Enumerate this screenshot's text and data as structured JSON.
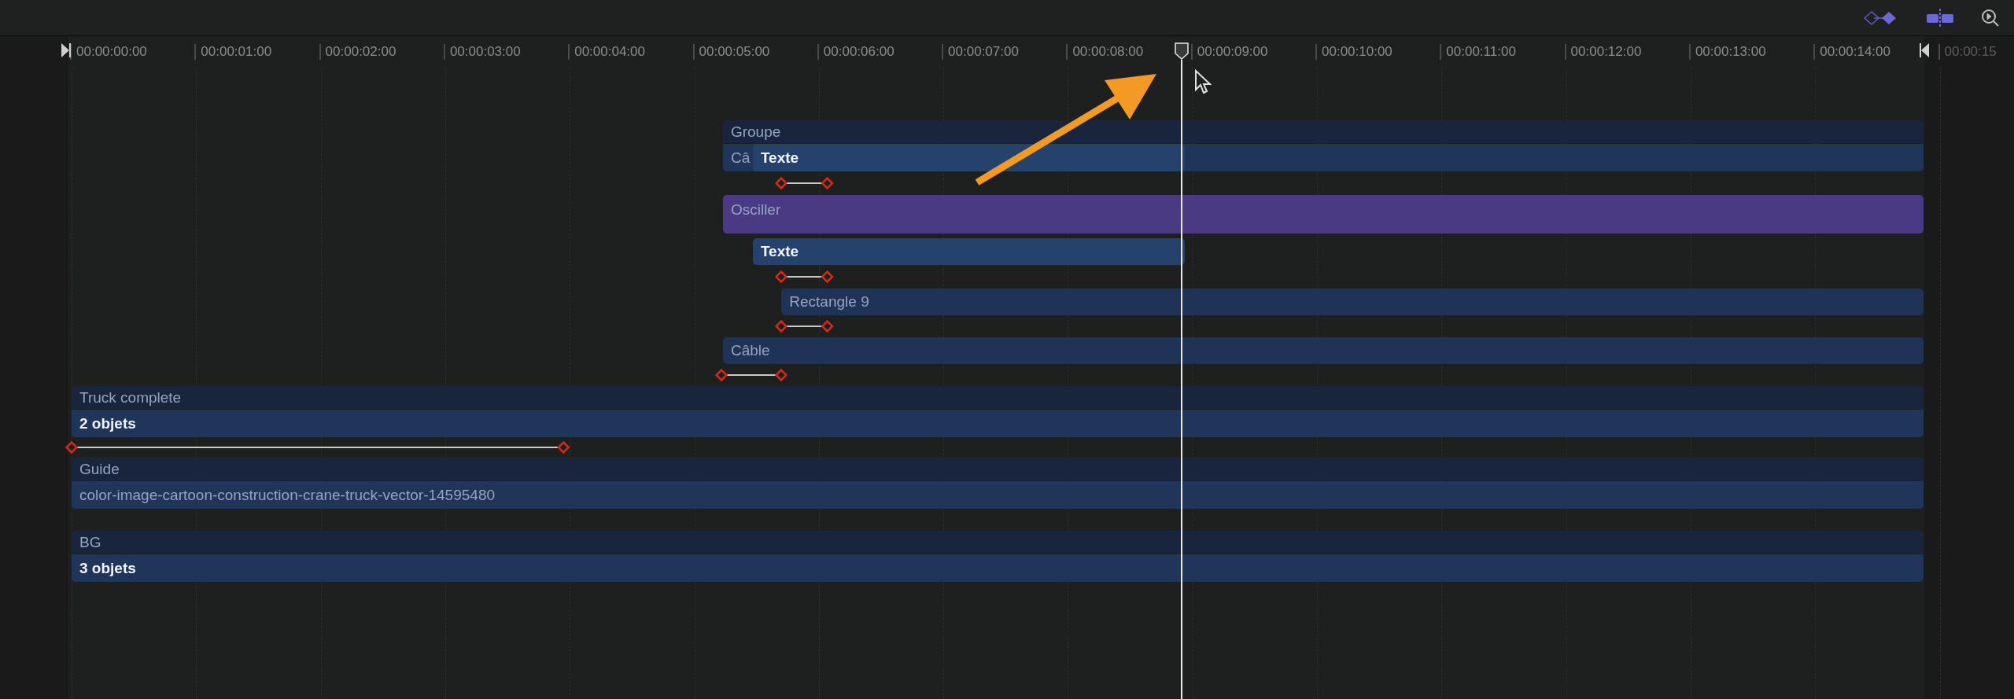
{
  "ruler": {
    "labels": [
      "00:00:00:00",
      "00:00:01:00",
      "00:00:02:00",
      "00:00:03:00",
      "00:00:04:00",
      "00:00:05:00",
      "00:00:06:00",
      "00:00:07:00",
      "00:00:08:00",
      "00:00:09:00",
      "00:00:10:00",
      "00:00:11:00",
      "00:00:12:00",
      "00:00:13:00",
      "00:00:14:00",
      "00:00:15"
    ]
  },
  "tracks": [
    {
      "kind": "group",
      "label": "Groupe",
      "body": {
        "text": "Câ",
        "bold": false
      },
      "overlay": {
        "label": "Texte"
      }
    },
    {
      "kind": "keyframes"
    },
    {
      "kind": "behavior",
      "label": "Osciller"
    },
    {
      "kind": "clip",
      "label": "Texte",
      "highlighted": true
    },
    {
      "kind": "keyframes"
    },
    {
      "kind": "clip",
      "label": "Rectangle 9",
      "highlighted": false
    },
    {
      "kind": "keyframes"
    },
    {
      "kind": "clip",
      "label": "Câble",
      "highlighted": false
    },
    {
      "kind": "keyframes"
    },
    {
      "kind": "group",
      "label": "Truck complete",
      "body": {
        "text": "2 objets",
        "bold": true
      }
    },
    {
      "kind": "keyframes"
    },
    {
      "kind": "group",
      "label": "Guide",
      "body": {
        "text": "color-image-cartoon-construction-crane-truck-vector-14595480",
        "bold": false
      }
    },
    {
      "kind": "gap"
    },
    {
      "kind": "group",
      "label": "BG",
      "body": {
        "text": "3 objets",
        "bold": true
      }
    }
  ]
}
